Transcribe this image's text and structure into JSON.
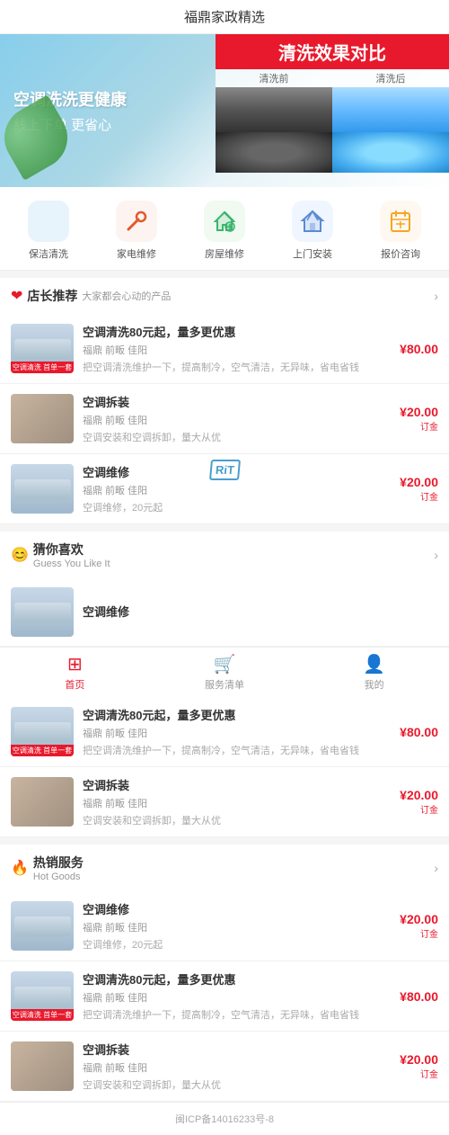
{
  "app": {
    "title": "福鼎家政精选"
  },
  "banner": {
    "left_title1": "空调洗洗更健康",
    "left_title2": "线上下单 更省心",
    "right_title": "清洗效果对比",
    "before_label": "清洗前",
    "after_label": "清洗后"
  },
  "categories": [
    {
      "id": "baojie",
      "label": "保洁清洗",
      "icon": "RiT",
      "icon_class": "icon-baojie"
    },
    {
      "id": "jiadian",
      "label": "家电维修",
      "icon": "🔧",
      "icon_class": "icon-jiadian"
    },
    {
      "id": "fangwu",
      "label": "房屋维修",
      "icon": "🔨",
      "icon_class": "icon-fangwu"
    },
    {
      "id": "shangmen",
      "label": "上门安装",
      "icon": "🏠",
      "icon_class": "icon-shangmen"
    },
    {
      "id": "baojia",
      "label": "报价咨询",
      "icon": "📅",
      "icon_class": "icon-baojia"
    }
  ],
  "sections": [
    {
      "id": "recommend",
      "icon": "heart",
      "title": "店长推荐",
      "subtitle": "大家都会心动的产品",
      "products": [
        {
          "id": "p1",
          "name": "空调清洗80元起，量多更优惠",
          "meta": "福鼎 前畈 佳阳",
          "desc": "把空调清洗维护一下，提高制冷，空气清洁，无异味，省电省钱",
          "price": "¥80.00",
          "deposit": "",
          "thumb_type": "ac_label",
          "thumb_label": "空调清洗 首单一套"
        },
        {
          "id": "p2",
          "name": "空调拆装",
          "meta": "福鼎 前畈 佳阳",
          "desc": "空调安装和空调拆卸，量大从优",
          "price": "¥20.00",
          "deposit": "订金",
          "thumb_type": "tool"
        },
        {
          "id": "p3",
          "name": "空调维修",
          "meta": "福鼎 前畈 佳阳",
          "desc": "空调维修，20元起",
          "price": "¥20.00",
          "deposit": "订金",
          "thumb_type": "ac"
        }
      ]
    },
    {
      "id": "guess",
      "icon": "guess",
      "title": "猜你喜欢",
      "subtitle": "Guess You Like It",
      "products": [
        {
          "id": "p4",
          "name": "空调维修",
          "meta": "",
          "desc": "",
          "price": "",
          "deposit": "",
          "thumb_type": "ac"
        }
      ]
    }
  ],
  "nav_after_guess": [
    {
      "id": "p5",
      "name": "空调清洗80元起，量多更优惠",
      "meta": "福鼎 前畈 佳阳",
      "desc": "把空调清洗维护一下，提高制冷，空气清洁，无异味，省电省钱",
      "price": "¥80.00",
      "deposit": "",
      "thumb_type": "ac_label",
      "thumb_label": "空调清洗 首单一套"
    },
    {
      "id": "p6",
      "name": "空调拆装",
      "meta": "福鼎 前畈 佳阳",
      "desc": "空调安装和空调拆卸，量大从优",
      "price": "¥20.00",
      "deposit": "订金",
      "thumb_type": "tool"
    }
  ],
  "hot_section": {
    "id": "hot",
    "icon": "fire",
    "title": "热销服务",
    "subtitle": "Hot Goods",
    "products": [
      {
        "id": "ph1",
        "name": "空调维修",
        "meta": "福鼎 前畈 佳阳",
        "desc": "空调维修，20元起",
        "price": "¥20.00",
        "deposit": "订金",
        "thumb_type": "ac"
      },
      {
        "id": "ph2",
        "name": "空调清洗80元起，量多更优惠",
        "meta": "福鼎 前畈 佳阳",
        "desc": "把空调清洗维护一下，提高制冷，空气清洁，无异味，省电省钱",
        "price": "¥80.00",
        "deposit": "",
        "thumb_type": "ac_label",
        "thumb_label": "空调清洗 首单一套"
      },
      {
        "id": "ph3",
        "name": "空调拆装",
        "meta": "福鼎 前畈 佳阳",
        "desc": "空调安装和空调拆卸，量大从优",
        "price": "¥20.00",
        "deposit": "订金",
        "thumb_type": "tool"
      }
    ]
  },
  "bottom_nav": [
    {
      "id": "home",
      "label": "首页",
      "icon": "⊞",
      "active": true
    },
    {
      "id": "service",
      "label": "服务清单",
      "icon": "🛒",
      "active": false
    },
    {
      "id": "mine",
      "label": "我的",
      "icon": "👤",
      "active": false
    }
  ],
  "footer": {
    "text": "闽ICP备14016233号-8"
  }
}
